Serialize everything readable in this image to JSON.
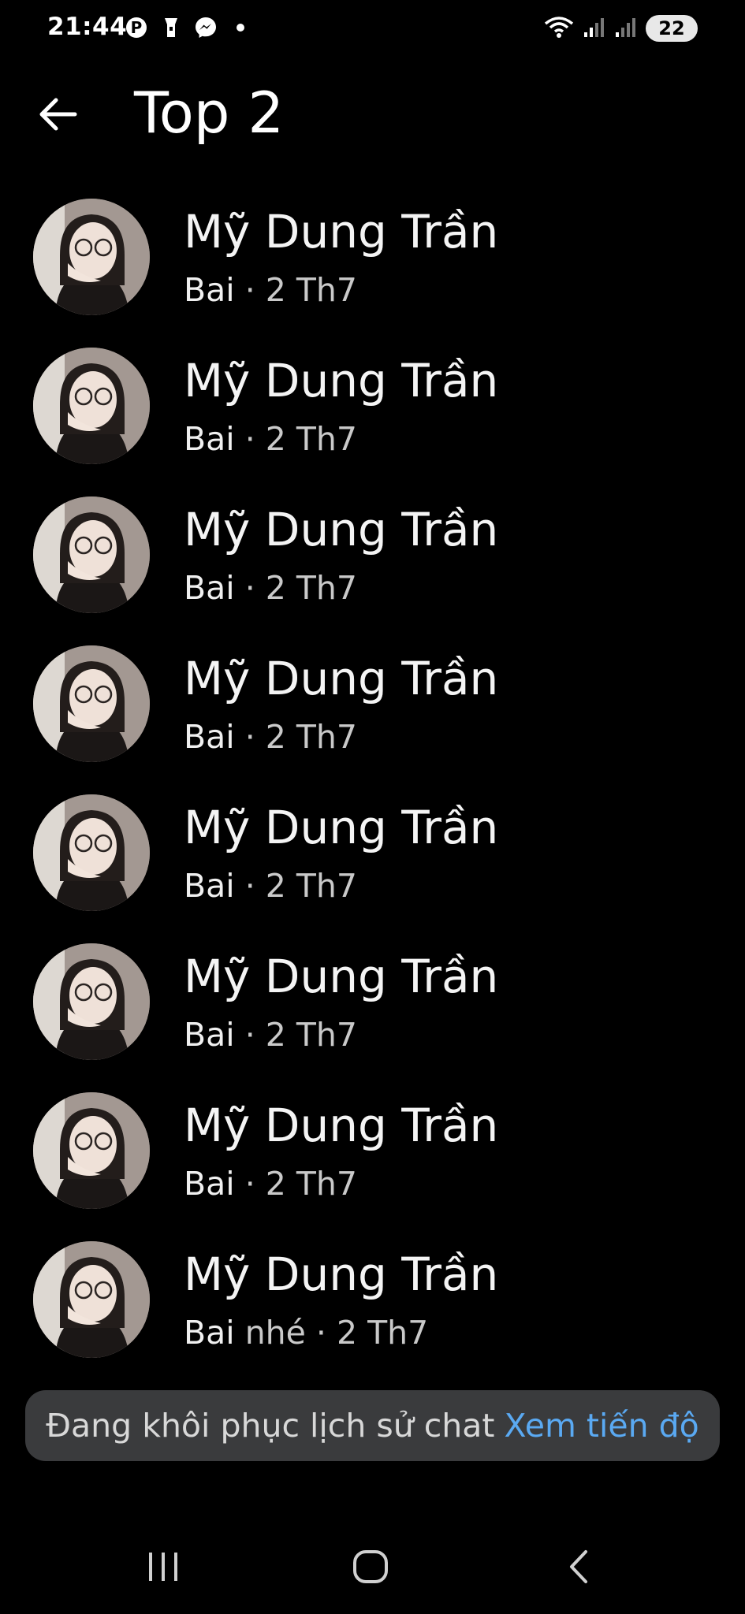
{
  "status_bar": {
    "time": "21:44",
    "battery": "22",
    "icons": [
      "pinterest-icon",
      "flashlight-icon",
      "messenger-icon",
      "dot-icon",
      "wifi-icon",
      "signal-icon",
      "signal-icon",
      "battery-icon"
    ]
  },
  "header": {
    "title": "Top 2",
    "back_icon": "arrow-left-icon"
  },
  "conversations": [
    {
      "name": "Mỹ Dung Trần",
      "message": "Bai",
      "message_extra": "",
      "time": " · 2 Th7"
    },
    {
      "name": "Mỹ Dung Trần",
      "message": "Bai",
      "message_extra": "",
      "time": " · 2 Th7"
    },
    {
      "name": "Mỹ Dung Trần",
      "message": "Bai",
      "message_extra": "",
      "time": " · 2 Th7"
    },
    {
      "name": "Mỹ Dung Trần",
      "message": "Bai",
      "message_extra": "",
      "time": " · 2 Th7"
    },
    {
      "name": "Mỹ Dung Trần",
      "message": "Bai",
      "message_extra": "",
      "time": " · 2 Th7"
    },
    {
      "name": "Mỹ Dung Trần",
      "message": "Bai",
      "message_extra": "",
      "time": " · 2 Th7"
    },
    {
      "name": "Mỹ Dung Trần",
      "message": "Bai",
      "message_extra": "",
      "time": " · 2 Th7"
    },
    {
      "name": "Mỹ Dung Trần",
      "message": "Bai",
      "message_extra": " nhé",
      "time": " · 2 Th7"
    }
  ],
  "toast": {
    "text": "Đang khôi phục lịch sử chat",
    "link": "Xem tiến độ"
  },
  "nav_bar": {
    "recents_icon": "recents-icon",
    "home_icon": "home-icon",
    "back_icon": "back-icon"
  },
  "colors": {
    "background": "#000000",
    "toast_bg": "#3a3b3d",
    "link": "#5aa9f2"
  }
}
